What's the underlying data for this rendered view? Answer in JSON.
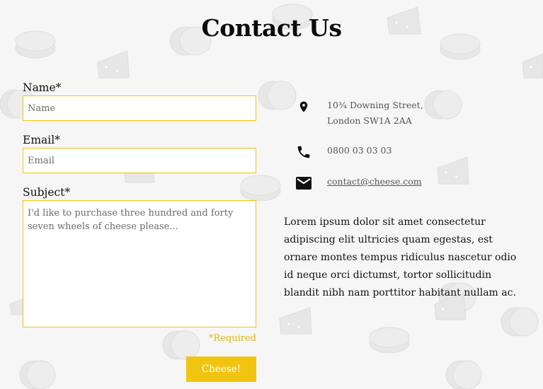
{
  "page": {
    "title": "Contact Us"
  },
  "form": {
    "name_label": "Name*",
    "name_placeholder": "Name",
    "email_label": "Email*",
    "email_placeholder": "Email",
    "subject_label": "Subject*",
    "subject_placeholder": "I'd like to purchase three hundred and forty seven wheels of cheese please...",
    "required_note": "*Required",
    "submit_label": "Cheese!"
  },
  "contact": {
    "address_line1": "10¾ Downing Street,",
    "address_line2": "London SW1A 2AA",
    "phone": "0800 03 03 03",
    "email": "contact@cheese.com"
  },
  "description": "Lorem ipsum dolor sit amet consectetur adipiscing elit ultricies quam egestas, est ornare montes tempus ridiculus nascetur odio id neque orci dictumst, tortor sollicitudin blandit nibh nam porttitor habitant nullam ac.",
  "colors": {
    "accent": "#f1c40f",
    "background": "#f6f6f6",
    "icon": "#111111"
  },
  "icons": {
    "address": "location-pin-icon",
    "phone": "phone-icon",
    "email": "mail-icon"
  }
}
